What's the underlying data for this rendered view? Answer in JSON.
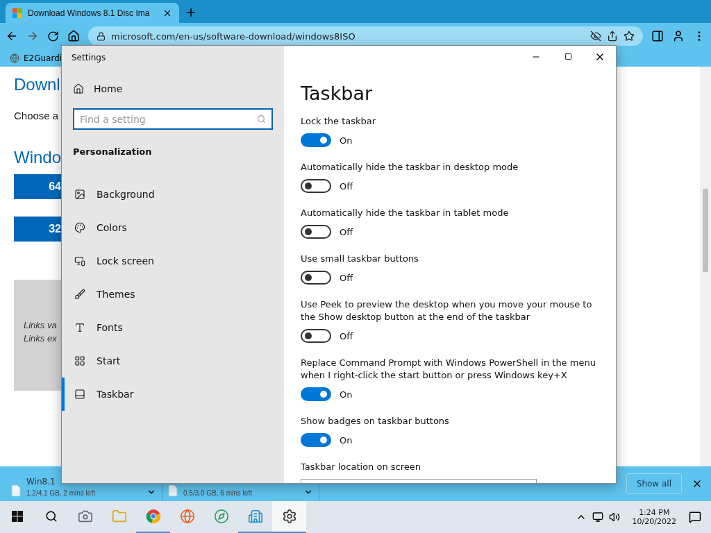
{
  "browser": {
    "tab_title": "Download Windows 8.1 Disc Ima",
    "url": "microsoft.com/en-us/software-download/windows8ISO",
    "bookmark": "E2Guardi"
  },
  "page": {
    "heading": "Downl",
    "intro": "Choose a",
    "subheading": "Windo",
    "buttons": [
      "64",
      "32"
    ],
    "notes": [
      "Links va",
      "Links ex"
    ]
  },
  "settings": {
    "title": "Settings",
    "home": "Home",
    "search": {
      "placeholder": "Find a setting"
    },
    "section": "Personalization",
    "nav": [
      {
        "label": "Background",
        "kind": "picture",
        "selected": false
      },
      {
        "label": "Colors",
        "kind": "palette",
        "selected": false
      },
      {
        "label": "Lock screen",
        "kind": "lock",
        "selected": false
      },
      {
        "label": "Themes",
        "kind": "themes",
        "selected": false
      },
      {
        "label": "Fonts",
        "kind": "fonts",
        "selected": false
      },
      {
        "label": "Start",
        "kind": "start",
        "selected": false
      },
      {
        "label": "Taskbar",
        "kind": "taskbar",
        "selected": true
      }
    ],
    "page_title": "Taskbar",
    "toggles": [
      {
        "label": "Lock the taskbar",
        "on": true,
        "state_text": "On"
      },
      {
        "label": "Automatically hide the taskbar in desktop mode",
        "on": false,
        "state_text": "Off"
      },
      {
        "label": "Automatically hide the taskbar in tablet mode",
        "on": false,
        "state_text": "Off"
      },
      {
        "label": "Use small taskbar buttons",
        "on": false,
        "state_text": "Off"
      },
      {
        "label": "Use Peek to preview the desktop when you move your mouse to the Show desktop button at the end of the taskbar",
        "on": false,
        "state_text": "Off"
      },
      {
        "label": "Replace Command Prompt with Windows PowerShell in the menu when I right-click the start button or press Windows key+X",
        "on": true,
        "state_text": "On"
      },
      {
        "label": "Show badges on taskbar buttons",
        "on": true,
        "state_text": "On"
      }
    ],
    "location_label": "Taskbar location on screen"
  },
  "downloads": {
    "items": [
      {
        "name": "Win8.1",
        "progress": "1.2/4.1 GB, 2 mins left"
      },
      {
        "progress": "0.5/3.0 GB, 6 mins left"
      }
    ],
    "show_all": "Show all"
  },
  "taskbar": {
    "apps": [
      {
        "kind": "camera",
        "running": false,
        "selected": false
      },
      {
        "kind": "folder",
        "running": false,
        "selected": false
      },
      {
        "kind": "chrome",
        "running": true,
        "selected": false
      },
      {
        "kind": "firefox",
        "running": false,
        "selected": false
      },
      {
        "kind": "edge",
        "running": false,
        "selected": false
      },
      {
        "kind": "buildings",
        "running": true,
        "selected": false
      },
      {
        "kind": "gear",
        "running": true,
        "selected": true
      }
    ],
    "time": "1:24 PM",
    "date": "10/20/2022"
  }
}
